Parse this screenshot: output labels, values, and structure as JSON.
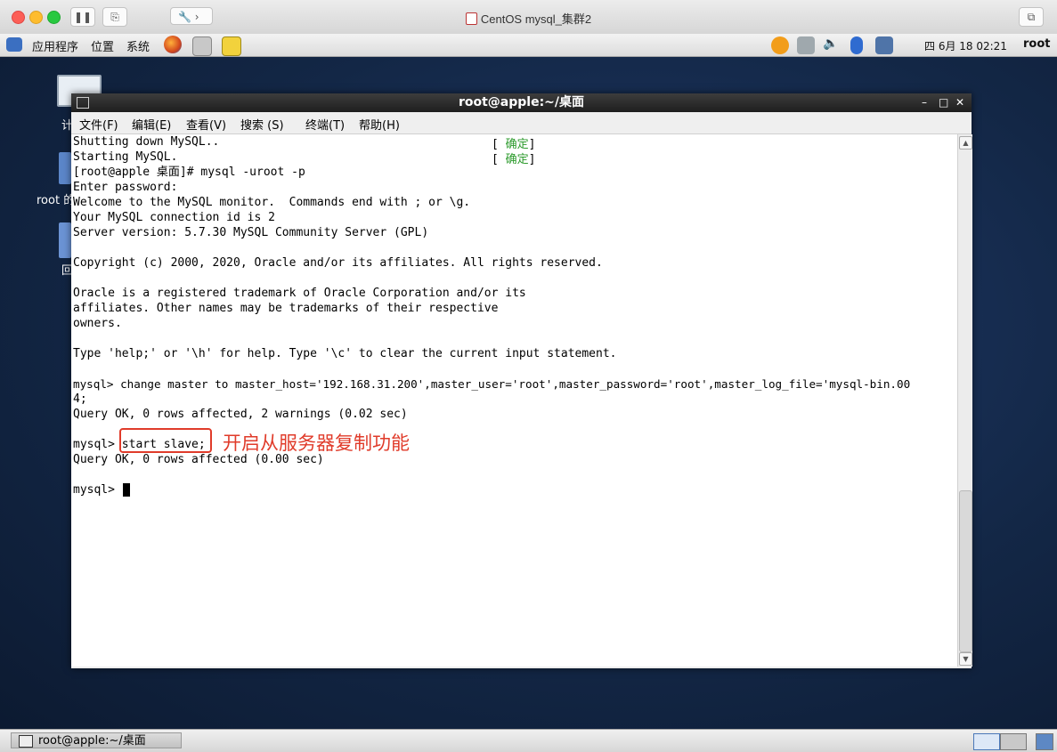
{
  "host": {
    "title": "CentOS mysql_集群2"
  },
  "panel": {
    "menus": [
      "应用程序",
      "位置",
      "系统"
    ],
    "clock": "四 6月 18 02:21",
    "user": "root"
  },
  "desktop": {
    "icon_labels": [
      "计",
      "root 的",
      "回"
    ]
  },
  "terminal": {
    "title": "root@apple:~/桌面",
    "controls": [
      "–",
      "□",
      "✕"
    ],
    "menu": [
      "文件(F)",
      "编辑(E)",
      "查看(V)",
      "搜索 (S)",
      "终端(T)",
      "帮助(H)"
    ],
    "lines": [
      "Shutting down MySQL..",
      "Starting MySQL.",
      "[root@apple 桌面]# mysql -uroot -p",
      "Enter password:",
      "Welcome to the MySQL monitor.  Commands end with ; or \\g.",
      "Your MySQL connection id is 2",
      "Server version: 5.7.30 MySQL Community Server (GPL)",
      "",
      "Copyright (c) 2000, 2020, Oracle and/or its affiliates. All rights reserved.",
      "",
      "Oracle is a registered trademark of Oracle Corporation and/or its",
      "affiliates. Other names may be trademarks of their respective",
      "owners.",
      "",
      "Type 'help;' or '\\h' for help. Type '\\c' to clear the current input statement.",
      "",
      "mysql> change master to master_host='192.168.31.200',master_user='root',master_password='root',master_log_file='mysql-bin.00",
      "4;",
      "Query OK, 0 rows affected, 2 warnings (0.02 sec)",
      "",
      "mysql> start slave;",
      "Query OK, 0 rows affected (0.00 sec)",
      "",
      "mysql> "
    ],
    "ok_label": "确定",
    "annotation": "开启从服务器复制功能"
  },
  "taskbar": {
    "window_label": "root@apple:~/桌面"
  }
}
